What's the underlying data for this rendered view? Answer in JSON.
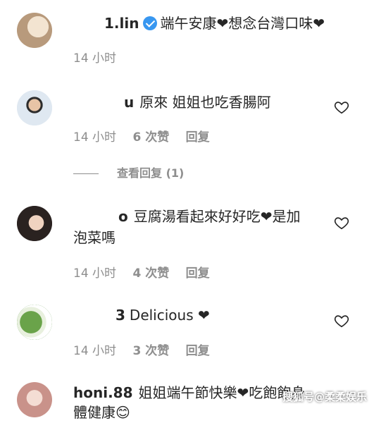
{
  "comments": [
    {
      "username": "1.lin",
      "text": "端午安康❤想念台灣口味❤",
      "time": "14 小时",
      "likes": "",
      "reply": ""
    },
    {
      "username": "u",
      "text": "原來 姐姐也吃香腸阿",
      "time": "14 小时",
      "likes": "6 次赞",
      "reply": "回复"
    },
    {
      "username": "o",
      "text": "豆腐湯看起來好好吃❤是加",
      "text2": "泡菜嗎",
      "time": "14 小时",
      "likes": "4 次赞",
      "reply": "回复"
    },
    {
      "username": "3",
      "text": "Delicious ❤",
      "time": "14 小时",
      "likes": "3 次赞",
      "reply": "回复"
    },
    {
      "username": "honi.88",
      "text": "姐姐端午節快樂❤吃飽飽身",
      "text2": "體健康😊"
    }
  ],
  "view_replies": "查看回复 (1)",
  "watermark": "搜狐号@柔柔娱乐",
  "colors": {
    "meta": "#8e8e8e",
    "verified": "#3897f0"
  }
}
